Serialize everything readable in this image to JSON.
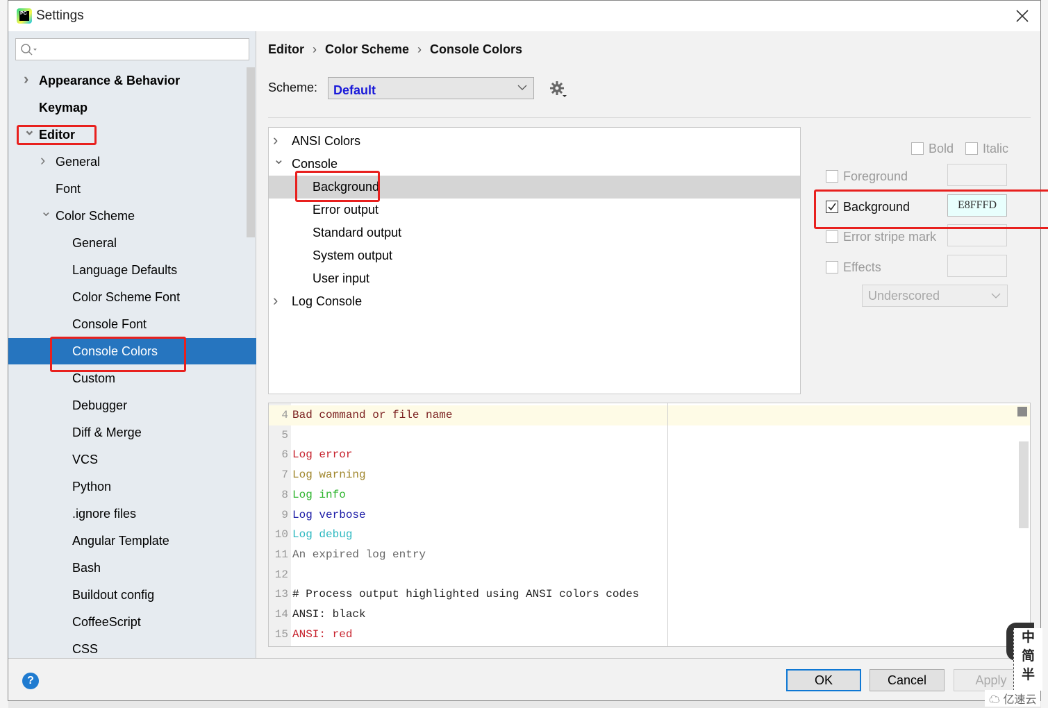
{
  "window": {
    "title": "Settings",
    "app_icon": "pycharm-icon",
    "close_icon": "close-icon"
  },
  "sidebar": {
    "search": {
      "value": "",
      "placeholder": "",
      "icon": "search-icon"
    },
    "items": [
      {
        "label": "Appearance & Behavior",
        "level": 0,
        "expandable": true,
        "expanded": false,
        "bold": true
      },
      {
        "label": "Keymap",
        "level": 0,
        "expandable": false,
        "bold": true
      },
      {
        "label": "Editor",
        "level": 0,
        "expandable": true,
        "expanded": true,
        "bold": true,
        "highlighted": true
      },
      {
        "label": "General",
        "level": 1,
        "expandable": true,
        "expanded": false
      },
      {
        "label": "Font",
        "level": 1,
        "expandable": false
      },
      {
        "label": "Color Scheme",
        "level": 1,
        "expandable": true,
        "expanded": true
      },
      {
        "label": "General",
        "level": 2
      },
      {
        "label": "Language Defaults",
        "level": 2
      },
      {
        "label": "Color Scheme Font",
        "level": 2
      },
      {
        "label": "Console Font",
        "level": 2
      },
      {
        "label": "Console Colors",
        "level": 2,
        "selected": true,
        "highlighted": true
      },
      {
        "label": "Custom",
        "level": 2
      },
      {
        "label": "Debugger",
        "level": 2
      },
      {
        "label": "Diff & Merge",
        "level": 2
      },
      {
        "label": "VCS",
        "level": 2
      },
      {
        "label": "Python",
        "level": 2
      },
      {
        "label": ".ignore files",
        "level": 2
      },
      {
        "label": "Angular Template",
        "level": 2
      },
      {
        "label": "Bash",
        "level": 2
      },
      {
        "label": "Buildout config",
        "level": 2
      },
      {
        "label": "CoffeeScript",
        "level": 2
      },
      {
        "label": "CSS",
        "level": 2
      }
    ]
  },
  "main": {
    "breadcrumb": [
      "Editor",
      "Color Scheme",
      "Console Colors"
    ],
    "breadcrumb_separator": "›",
    "scheme": {
      "label": "Scheme:",
      "value": "Default",
      "gear_icon": "gear-icon"
    },
    "attributes": [
      {
        "label": "ANSI Colors",
        "level": 0,
        "expandable": true,
        "expanded": false
      },
      {
        "label": "Console",
        "level": 0,
        "expandable": true,
        "expanded": true
      },
      {
        "label": "Background",
        "level": 1,
        "selected": true,
        "highlighted": true
      },
      {
        "label": "Error output",
        "level": 1
      },
      {
        "label": "Standard output",
        "level": 1
      },
      {
        "label": "System output",
        "level": 1
      },
      {
        "label": "User input",
        "level": 1
      },
      {
        "label": "Log Console",
        "level": 0,
        "expandable": true,
        "expanded": false
      }
    ],
    "options": {
      "bold": {
        "label": "Bold",
        "checked": false
      },
      "italic": {
        "label": "Italic",
        "checked": false
      },
      "foreground": {
        "label": "Foreground",
        "checked": false,
        "color": ""
      },
      "background": {
        "label": "Background",
        "checked": true,
        "color": "E8FFFD",
        "color_hex": "#E8FFFD"
      },
      "error_stripe": {
        "label": "Error stripe mark",
        "checked": false,
        "color": ""
      },
      "effects": {
        "label": "Effects",
        "checked": false,
        "color": "",
        "effect_type": "Underscored"
      }
    },
    "preview": {
      "lines": [
        {
          "n": "4",
          "text": "Bad command or file name",
          "color": "#7a1f1f",
          "current": true
        },
        {
          "n": "5",
          "text": "",
          "color": "#000000"
        },
        {
          "n": "6",
          "text": "Log error",
          "color": "#c7222d"
        },
        {
          "n": "7",
          "text": "Log warning",
          "color": "#a0862c"
        },
        {
          "n": "8",
          "text": "Log info",
          "color": "#2fb52f"
        },
        {
          "n": "9",
          "text": "Log verbose",
          "color": "#1a1aa6"
        },
        {
          "n": "10",
          "text": "Log debug",
          "color": "#2bb8c0"
        },
        {
          "n": "11",
          "text": "An expired log entry",
          "color": "#666666"
        },
        {
          "n": "12",
          "text": "",
          "color": "#000000"
        },
        {
          "n": "13",
          "text": "# Process output highlighted using ANSI colors codes",
          "color": "#222222"
        },
        {
          "n": "14",
          "text": "ANSI: black",
          "color": "#222222"
        },
        {
          "n": "15",
          "text": "ANSI: red",
          "color": "#c7222d"
        }
      ]
    }
  },
  "footer": {
    "help_label": "?",
    "ok_label": "OK",
    "cancel_label": "Cancel",
    "apply_label": "Apply"
  },
  "overlay": {
    "ime_chars": [
      "中",
      "简",
      "半"
    ],
    "watermark": "亿速云"
  }
}
